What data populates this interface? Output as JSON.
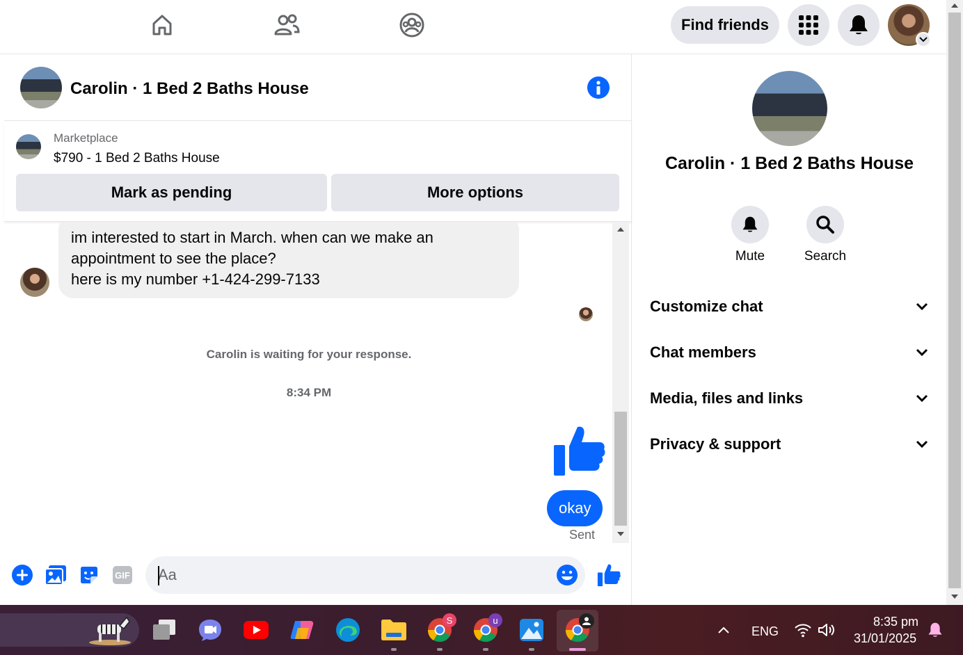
{
  "topnav": {
    "find_friends_label": "Find friends"
  },
  "chat": {
    "title": "Carolin · 1 Bed 2 Baths House",
    "marketplace_label": "Marketplace",
    "listing": "$790 - 1 Bed 2 Baths House",
    "mark_pending_label": "Mark as pending",
    "more_options_label": "More options",
    "incoming_message": {
      "lines": [
        "im interested to start in March. when can we make an",
        "appointment to see the place?",
        "here is my number +1-424-299-7133"
      ]
    },
    "waiting_text": "Carolin is waiting for your response.",
    "timestamp": "8:34 PM",
    "outgoing_message": "okay",
    "sent_status": "Sent",
    "composer_placeholder": "Aa"
  },
  "info_panel": {
    "title": "Carolin · 1 Bed 2 Baths House",
    "actions": [
      {
        "label": "Mute",
        "icon": "bell-icon"
      },
      {
        "label": "Search",
        "icon": "search-icon"
      }
    ],
    "sections": [
      {
        "label": "Customize chat"
      },
      {
        "label": "Chat members"
      },
      {
        "label": "Media, files and links"
      },
      {
        "label": "Privacy & support"
      }
    ]
  },
  "taskbar": {
    "language": "ENG",
    "time": "8:35 pm",
    "date": "31/01/2025",
    "badges": [
      "S",
      "u"
    ]
  },
  "colors": {
    "accent": "#0866ff",
    "bubble_in": "#f0f0f0",
    "button_bg": "#e4e6eb",
    "secondary_text": "#65676b"
  }
}
